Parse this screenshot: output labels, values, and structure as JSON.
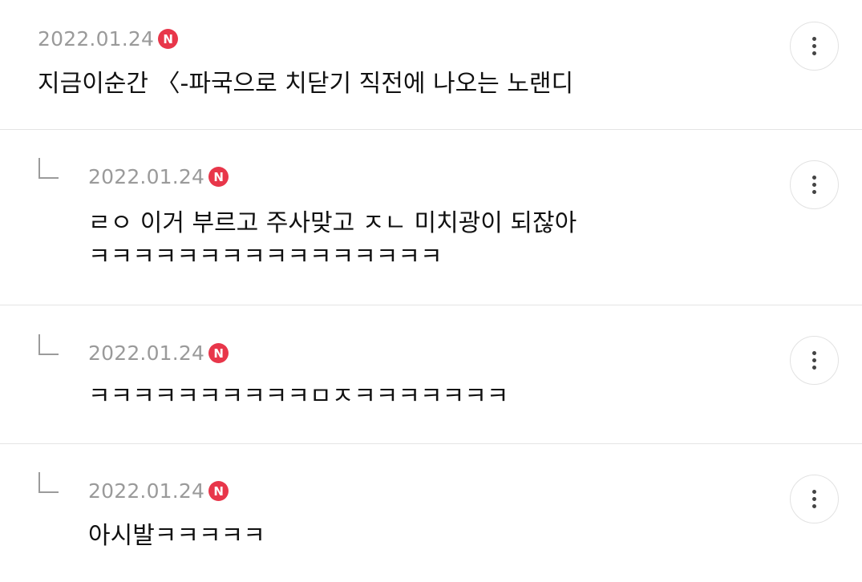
{
  "comments": [
    {
      "date": "2022.01.24",
      "badge": "N",
      "text": "지금이순간 〈-파국으로 치닫기 직전에 나오는 노랜디",
      "is_reply": false
    },
    {
      "date": "2022.01.24",
      "badge": "N",
      "text": "ㄹㅇ 이거 부르고 주사맞고 ㅈㄴ 미치광이 되잖아\nㅋㅋㅋㅋㅋㅋㅋㅋㅋㅋㅋㅋㅋㅋㅋㅋ",
      "is_reply": true
    },
    {
      "date": "2022.01.24",
      "badge": "N",
      "text": "ㅋㅋㅋㅋㅋㅋㅋㅋㅋㅋㅁㅈㅋㅋㅋㅋㅋㅋㅋ",
      "is_reply": true
    },
    {
      "date": "2022.01.24",
      "badge": "N",
      "text": "아시발ㅋㅋㅋㅋㅋ",
      "is_reply": true
    }
  ],
  "icons": {
    "more": "more-vertical-icon",
    "reply": "reply-arrow-icon"
  },
  "colors": {
    "badge": "#e8364a",
    "date": "#9a9a9a",
    "divider": "#e4e4e4"
  }
}
